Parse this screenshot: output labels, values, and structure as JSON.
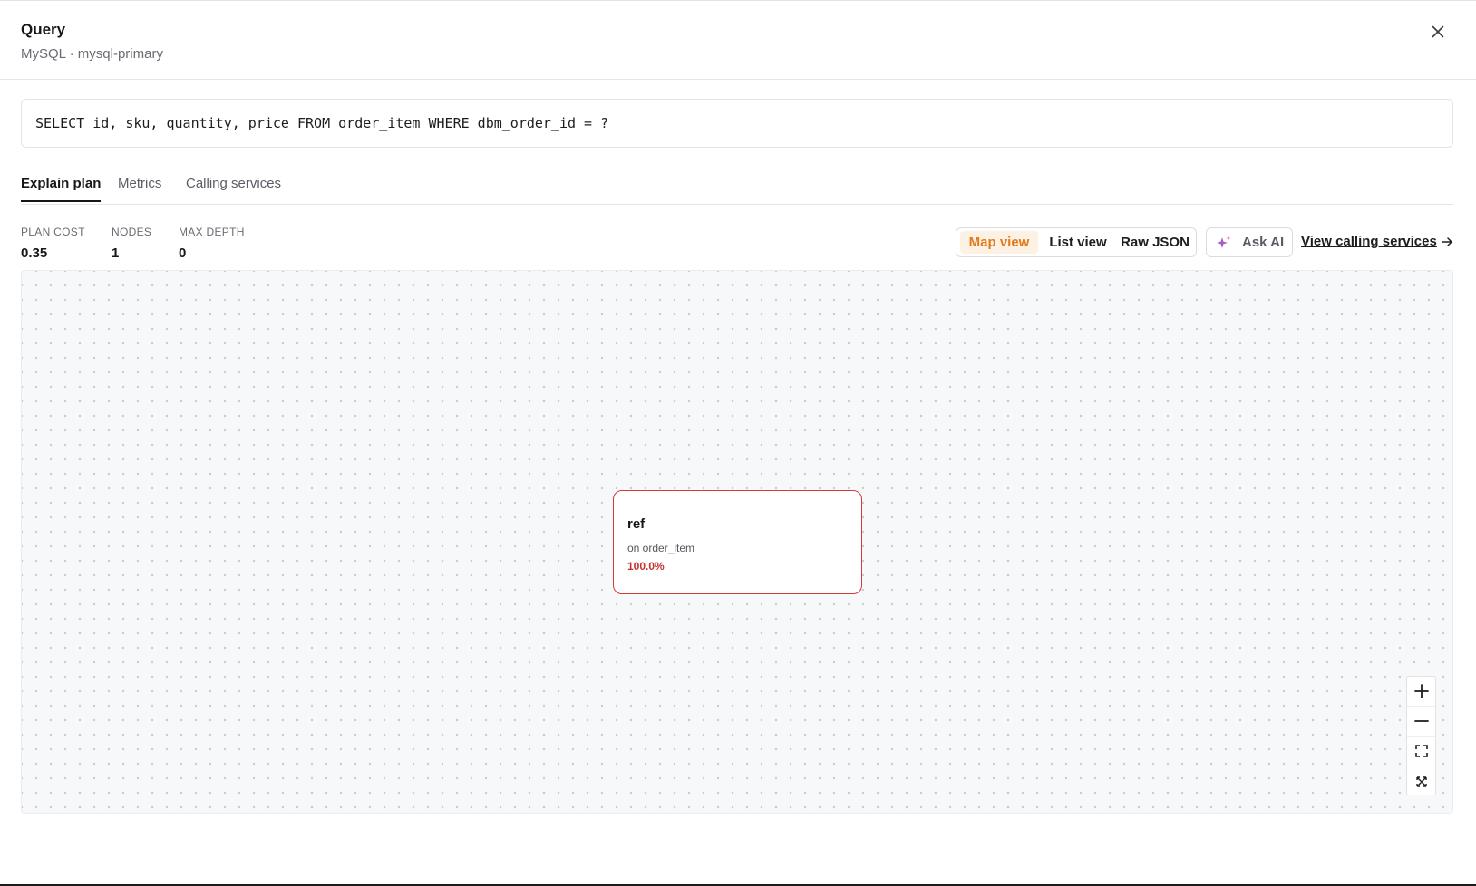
{
  "header": {
    "title": "Query",
    "subtitle": "MySQL · mysql-primary"
  },
  "sql": "SELECT id, sku, quantity, price FROM order_item WHERE dbm_order_id = ?",
  "tabs": [
    {
      "label": "Explain plan",
      "active": true
    },
    {
      "label": "Metrics",
      "active": false
    },
    {
      "label": "Calling services",
      "active": false
    }
  ],
  "stats": [
    {
      "label": "PLAN COST",
      "value": "0.35"
    },
    {
      "label": "NODES",
      "value": "1"
    },
    {
      "label": "MAX DEPTH",
      "value": "0"
    }
  ],
  "view_toggle": {
    "options": [
      "Map view",
      "List view",
      "Raw JSON"
    ],
    "selected": "Map view"
  },
  "ask_ai_label": "Ask AI",
  "view_calling_services_label": "View calling services",
  "plan_node": {
    "title": "ref",
    "subtitle": "on order_item",
    "percent": "100.0%"
  },
  "icons": [
    "close-icon",
    "sparkle-icon",
    "arrow-right-icon",
    "zoom-in-icon",
    "zoom-out-icon",
    "fit-view-icon",
    "fullscreen-icon"
  ],
  "colors": {
    "accent_orange": "#e07a1a",
    "accent_orange_bg": "#fdf1e4",
    "node_border_red": "#d33a3a",
    "node_percent_red": "#c63232",
    "canvas_bg": "#f7f8fa"
  }
}
